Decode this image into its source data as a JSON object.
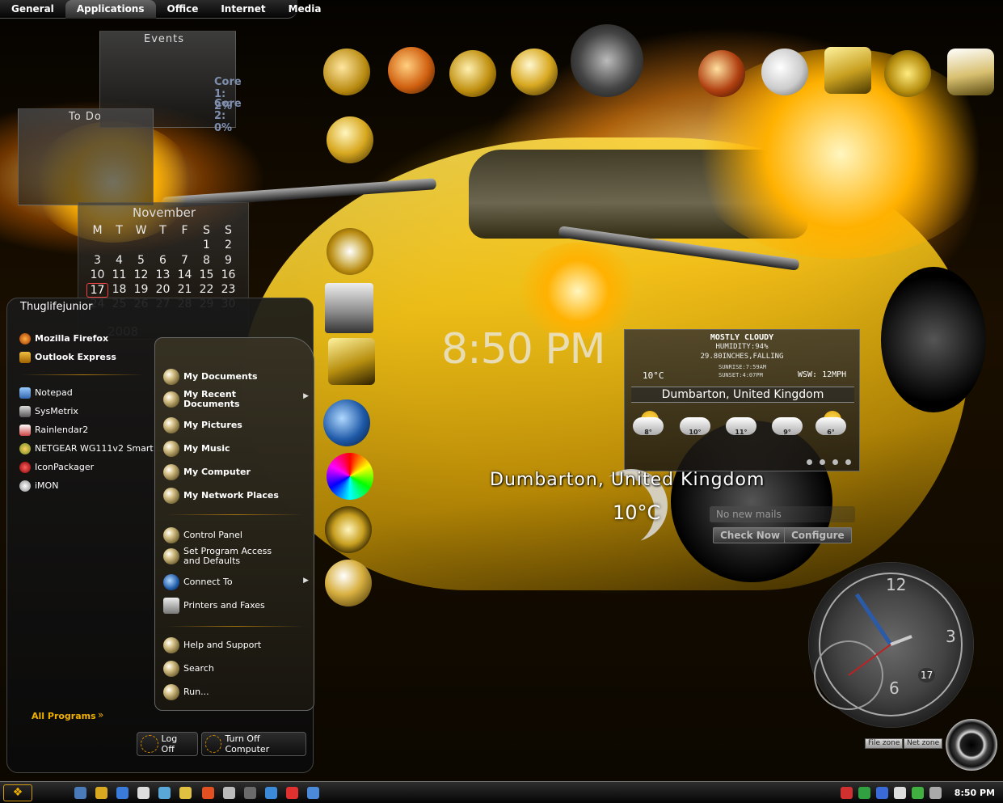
{
  "tabs": [
    "General",
    "Applications",
    "Office",
    "Internet",
    "Media"
  ],
  "events_panel": {
    "title": "Events",
    "core1": "Core 1:  2%",
    "core2": "Core 2:  0%"
  },
  "todo_panel": {
    "title": "To Do"
  },
  "calendar": {
    "month": "November",
    "weekdays": [
      "M",
      "T",
      "W",
      "T",
      "F",
      "S",
      "S"
    ],
    "days": [
      "",
      "",
      "",
      "",
      "",
      "1",
      "2",
      "3",
      "4",
      "5",
      "6",
      "7",
      "8",
      "9",
      "10",
      "11",
      "12",
      "13",
      "14",
      "15",
      "16",
      "17",
      "18",
      "19",
      "20",
      "21",
      "22",
      "23",
      "24",
      "25",
      "26",
      "27",
      "28",
      "29",
      "30"
    ],
    "today": "17",
    "year": "2008"
  },
  "start_menu": {
    "user": "Thuglifejunior",
    "pinned": [
      "Mozilla Firefox",
      "Outlook Express"
    ],
    "recent": [
      "Notepad",
      "SysMetrix",
      "Rainlendar2",
      "NETGEAR WG111v2 Smart ...",
      "IconPackager",
      "iMON"
    ],
    "all_programs": "All Programs",
    "places": [
      "My Documents",
      "My Recent Documents",
      "My Pictures",
      "My Music",
      "My Computer",
      "My Network Places"
    ],
    "system": [
      "Control Panel",
      "Set Program Access and Defaults",
      "Connect To",
      "Printers and Faxes"
    ],
    "help": [
      "Help and Support",
      "Search",
      "Run..."
    ],
    "log_off": "Log Off",
    "turn_off": "Turn Off Computer"
  },
  "clock": {
    "time": "8:50 PM"
  },
  "weather": {
    "condition": "MOSTLY CLOUDY",
    "humidity": "HUMIDITY:94%",
    "pressure": "29.80INCHES,FALLING",
    "sunrise": "SUNRISE:7:59AM",
    "sunset": "SUNSET:4:07PM",
    "temp": "10°C",
    "wind": "WSW: 12MPH",
    "location": "Dumbarton, United Kingdom",
    "forecast": [
      "8°",
      "10°",
      "11°",
      "9°",
      "6°"
    ],
    "big_location": "Dumbarton, United Kingdom",
    "big_temp": "10°C"
  },
  "mail": {
    "status": "No new mails",
    "check": "Check Now",
    "configure": "Configure"
  },
  "analog_clock": {
    "n12": "12",
    "n3": "3",
    "n6": "6",
    "date": "17"
  },
  "zones": [
    "File zone",
    "Net zone"
  ],
  "taskbar": {
    "time": "8:50 PM"
  },
  "colors": {
    "accent": "#f0b000",
    "car": "#f3c419"
  }
}
